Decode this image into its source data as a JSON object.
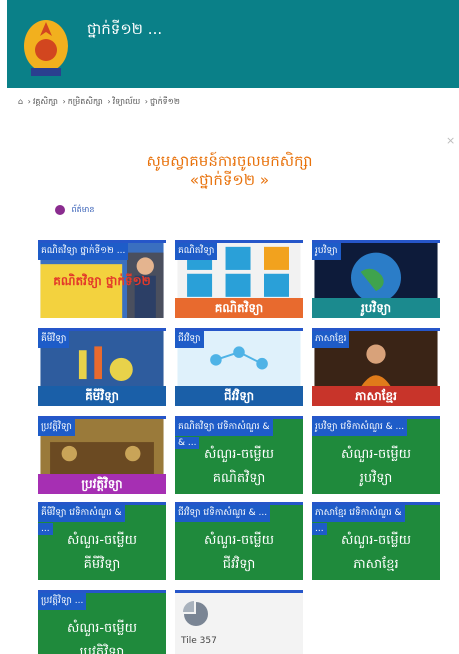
{
  "header": {
    "title": "ថ្នាក់ទី១២ ..."
  },
  "breadcrumb": {
    "items": [
      "វគ្គសិក្សា",
      "កម្រិតសិក្សា",
      "វិទ្យាល័យ",
      "ថ្នាក់ទី១២"
    ]
  },
  "welcome": {
    "line1": "សូមស្វាគមន៍ការចូលមកសិក្សា",
    "line2": "«ថ្នាក់ទី១២ »"
  },
  "user": {
    "label": "ព័ត៌មាន"
  },
  "tiles": [
    {
      "tag": "គណិតវិទ្យា ថ្នាក់ទី១២ ...",
      "banner": "គណិតវិទ្យា ថ្នាក់ទី១២",
      "color": "#cf7a2b"
    },
    {
      "tag": "គណិតវិទ្យា",
      "banner": "គណិតវិទ្យា",
      "color": "#e86a2e"
    },
    {
      "tag": "រូបវិទ្យា",
      "banner": "រូបវិទ្យា",
      "color": "#1b8a8e"
    },
    {
      "tag": "គីមីវិទ្យា",
      "banner": "គីមីវិទ្យា",
      "color": "#1a5fa8"
    },
    {
      "tag": "ជីវវិទ្យា",
      "banner": "ជីវវិទ្យា",
      "color": "#1a5fa8"
    },
    {
      "tag": "ភាសាខ្មែរ",
      "banner": "ភាសាខ្មែរ",
      "color": "#c8342a"
    },
    {
      "tag": "ប្រវត្តិវិទ្យា",
      "banner": "ប្រវត្តិវិទ្យា",
      "color": "#a62fb3"
    },
    {
      "tag": "គណិតវិទ្យា វេទិកាសំណួរ &",
      "tag2": "& ...",
      "line1": "សំណួរ-ចម្លើយ",
      "line2": "គណិតវិទ្យា"
    },
    {
      "tag": "រូបវិទ្យា វេទិកាសំណួរ & ...",
      "line1": "សំណួរ-ចម្លើយ",
      "line2": "រូបវិទ្យា"
    },
    {
      "tag": "គីមីវិទ្យា វេទិកាសំណួរ &",
      "tag2": "...",
      "line1": "សំណួរ-ចម្លើយ",
      "line2": "គីមីវិទ្យា"
    },
    {
      "tag": "ជីវវិទ្យា វេទិកាសំណួរ & ...",
      "line1": "សំណួរ-ចម្លើយ",
      "line2": "ជីវវិទ្យា"
    },
    {
      "tag": "ភាសាខ្មែរ វេទិកាសំណួរ &",
      "tag2": "...",
      "line1": "សំណួរ-ចម្លើយ",
      "line2": "ភាសាខ្មែរ"
    },
    {
      "tag": "ប្រវត្តិវិទ្យា ...",
      "line1": "សំណួរ-ចម្លើយ",
      "line2": "ប្រវត្តិវិទ្យា"
    },
    {
      "label": "Tile 357"
    }
  ]
}
